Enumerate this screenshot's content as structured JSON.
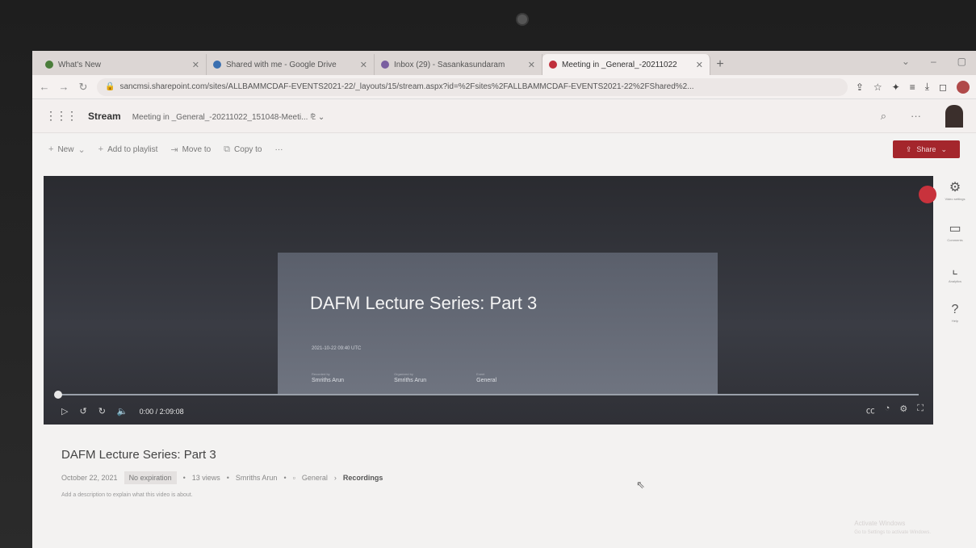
{
  "browser": {
    "tabs": [
      {
        "title": "What's New",
        "favicon_color": "#4a7d3a",
        "active": false
      },
      {
        "title": "Shared with me - Google Drive",
        "favicon_color": "#3a6fb0",
        "active": false
      },
      {
        "title": "Inbox (29) - Sasankasundaram",
        "favicon_color": "#7a5fa0",
        "active": false
      },
      {
        "title": "Meeting in _General_-20211022",
        "favicon_color": "#c0303c",
        "active": true
      }
    ],
    "new_tab_label": "+",
    "url": "sancmsi.sharepoint.com/sites/ALLBAMMCDAF-EVENTS2021-22/_layouts/15/stream.aspx?id=%2Fsites%2FALLBAMMCDAF-EVENTS2021-22%2FShared%2..."
  },
  "app": {
    "name": "Stream",
    "breadcrumb": "Meeting in _General_-20211022_151048-Meeti... ⅊ ⌄"
  },
  "commands": {
    "new": "New",
    "add_to_playlist": "Add to playlist",
    "move_to": "Move to",
    "copy_to": "Copy to",
    "more": "···",
    "share": "Share"
  },
  "video": {
    "slide_title": "DAFM Lecture Series: Part 3",
    "slide_date": "2021-10-22 09:40 UTC",
    "slide_meta": [
      {
        "key": "Recorded by",
        "value": "Smriths Arun"
      },
      {
        "key": "Organized by",
        "value": "Smriths Arun"
      },
      {
        "key": "Event",
        "value": "General"
      }
    ],
    "time": "0:00 / 2:09:08",
    "progress_fraction": 0
  },
  "right_pane": [
    {
      "icon": "settings-icon",
      "label": "Video settings"
    },
    {
      "icon": "comments-icon",
      "label": "Comments"
    },
    {
      "icon": "analytics-icon",
      "label": "Analytics"
    },
    {
      "icon": "help-icon",
      "label": "Help"
    }
  ],
  "details": {
    "title": "DAFM Lecture Series: Part 3",
    "date": "October 22, 2021",
    "expiration": "No expiration",
    "views": "13 views",
    "author": "Smriths Arun",
    "channel": "General",
    "folder": "Recordings",
    "description_placeholder": "Add a description to explain what this video is about."
  },
  "watermark": {
    "line1": "Activate Windows",
    "line2": "Go to Settings to activate Windows."
  },
  "colors": {
    "accent": "#a4262c",
    "record": "#c8323c"
  }
}
